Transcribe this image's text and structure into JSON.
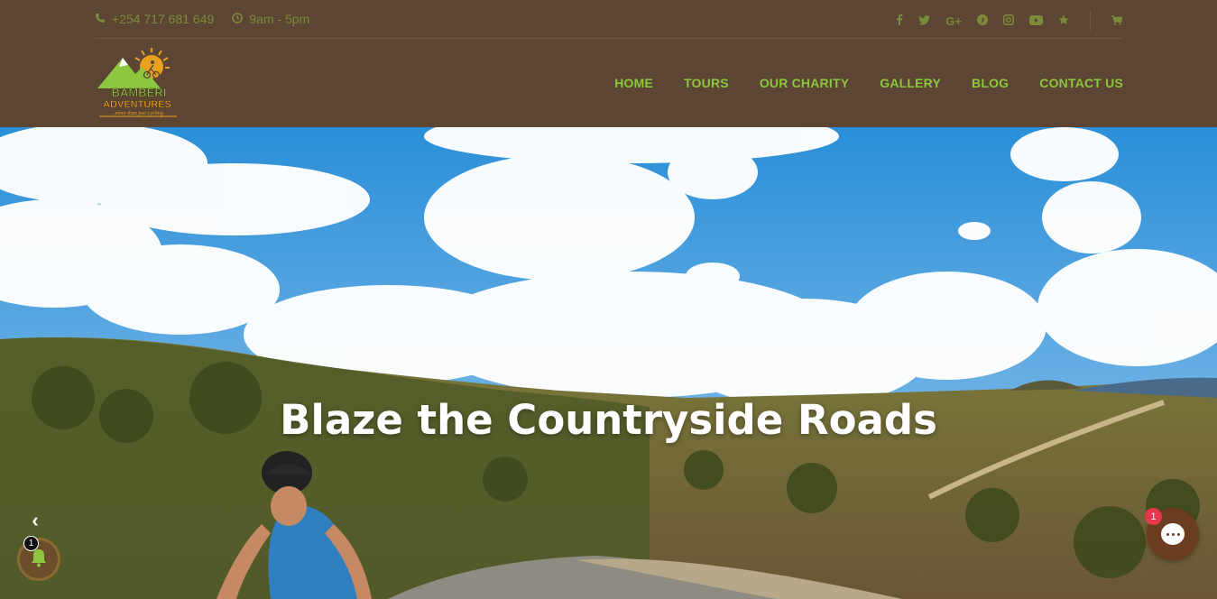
{
  "topbar": {
    "phone": "+254 717 681 649",
    "hours": "9am - 5pm",
    "social_icons": [
      "facebook-icon",
      "twitter-icon",
      "google-plus-icon",
      "pinterest-icon",
      "instagram-icon",
      "youtube-icon",
      "star-icon"
    ],
    "cart_icon": "cart-icon"
  },
  "logo": {
    "line1": "BAMBERI",
    "line2": "ADVENTURES",
    "tagline": "...more than just cycling"
  },
  "nav": {
    "items": [
      {
        "label": "HOME"
      },
      {
        "label": "TOURS"
      },
      {
        "label": "OUR CHARITY"
      },
      {
        "label": "GALLERY"
      },
      {
        "label": "BLOG"
      },
      {
        "label": "CONTACT US"
      }
    ]
  },
  "hero": {
    "headline": "Blaze the Countryside Roads",
    "prev_arrow": "‹"
  },
  "widgets": {
    "bell_badge": "1",
    "chat_badge": "1"
  },
  "colors": {
    "header_bg": "#5c4532",
    "nav_text": "#8dc63f",
    "topbar_text": "#7a8c3a",
    "chat_button": "#6a3d1f",
    "badge_red": "#e8364f"
  }
}
